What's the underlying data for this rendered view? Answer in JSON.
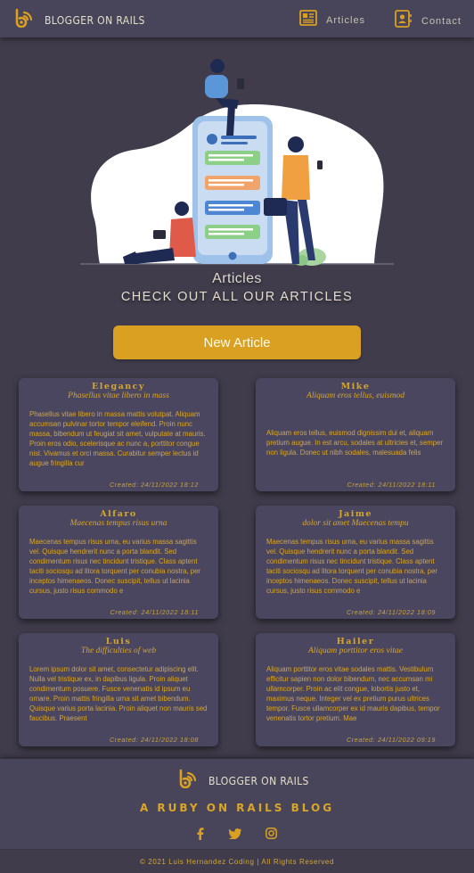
{
  "navbar": {
    "brand": "BLOGGER ON RAILS",
    "links": [
      {
        "label": "Articles",
        "icon": "newspaper-icon"
      },
      {
        "label": "Contact",
        "icon": "contact-card-icon"
      }
    ]
  },
  "header": {
    "title": "Articles",
    "subtitle": "CHECK OUT ALL OUR ARTICLES",
    "new_button": "New Article"
  },
  "articles": [
    {
      "author": "Elegancy",
      "title": "Phasellus vitae libero in mass",
      "body": "Phasellus vitae libero in massa mattis volutpat. Aliquam accumsan pulvinar tortor tempor eleifend. Proin nunc massa, bibendum ut feugiat sit amet, vulputate at mauris. Proin eros odio, scelerisque ac nunc a, porttitor congue nisl. Vivamus et orci massa. Curabitur semper lectus id augue fringilla cur",
      "created": "Created: 24/11/2022  18:12"
    },
    {
      "author": "Mike",
      "title": "Aliquam eros tellus, euismod",
      "body": "Aliquam eros tellus, euismod dignissim dui et, aliquam pretium augue. In est arcu, sodales at ultricies et, semper non ligula. Donec ut nibh sodales, malesuada felis",
      "created": "Created: 24/11/2022  18:11"
    },
    {
      "author": "Alfaro",
      "title": "Maecenas tempus risus urna",
      "body": "Maecenas tempus risus urna, eu varius massa sagittis vel. Quisque hendrerit nunc a porta blandit. Sed condimentum risus nec tincidunt tristique. Class aptent taciti sociosqu ad litora torquent per conubia nostra, per inceptos himenaeos. Donec suscipit, tellus ut lacinia cursus, justo risus commodo e",
      "created": "Created: 24/11/2022  18:11"
    },
    {
      "author": "Jaime",
      "title": "dolor sit amet Maecenas tempu",
      "body": "Maecenas tempus risus urna, eu varius massa sagittis vel. Quisque hendrerit nunc a porta blandit. Sed condimentum risus nec tincidunt tristique. Class aptent taciti sociosqu ad litora torquent per conubia nostra, per inceptos himenaeos. Donec suscipit, tellus ut lacinia cursus, justo risus commodo e",
      "created": "Created: 24/11/2022  18:09"
    },
    {
      "author": "Luis",
      "title": "The difficulties of web",
      "body": "Lorem ipsum dolor sit amet, consectetur adipiscing elit. Nulla vel tristique ex, in dapibus ligula. Proin aliquet condimentum posuere. Fusce venenatis id ipsum eu ornare. Proin mattis fringilla urna sit amet bibendum. Quisque varius porta lacinia. Proin aliquet non mauris sed faucibus. Praesent",
      "created": "Created: 24/11/2022  18:08"
    },
    {
      "author": "Hailer",
      "title": "Aliquam porttitor eros vitae",
      "body": "Aliquam porttitor eros vitae sodales mattis. Vestibulum efficitur sapien non dolor bibendum, nec accumsan mi ullamcorper. Proin ac elit congue, lobortis justo et, maximus neque. Integer vel ex pretium purus ultrices tempor. Fusce ullamcorper ex id mauris dapibus, tempor venenatis tortor pretium. Mae",
      "created": "Created: 24/11/2022  09:19"
    }
  ],
  "footer": {
    "brand": "BLOGGER ON RAILS",
    "tagline": "A RUBY ON RAILS BLOG",
    "socials": [
      "facebook-icon",
      "twitter-icon",
      "instagram-icon"
    ],
    "copyright": "© 2021 Luis Hernandez Coding | All Rights Reserved"
  },
  "colors": {
    "background": "#403c4c",
    "navbar": "#48445a",
    "card": "#4a4660",
    "accent": "#d9a021",
    "accent_text": "#d9a628"
  }
}
